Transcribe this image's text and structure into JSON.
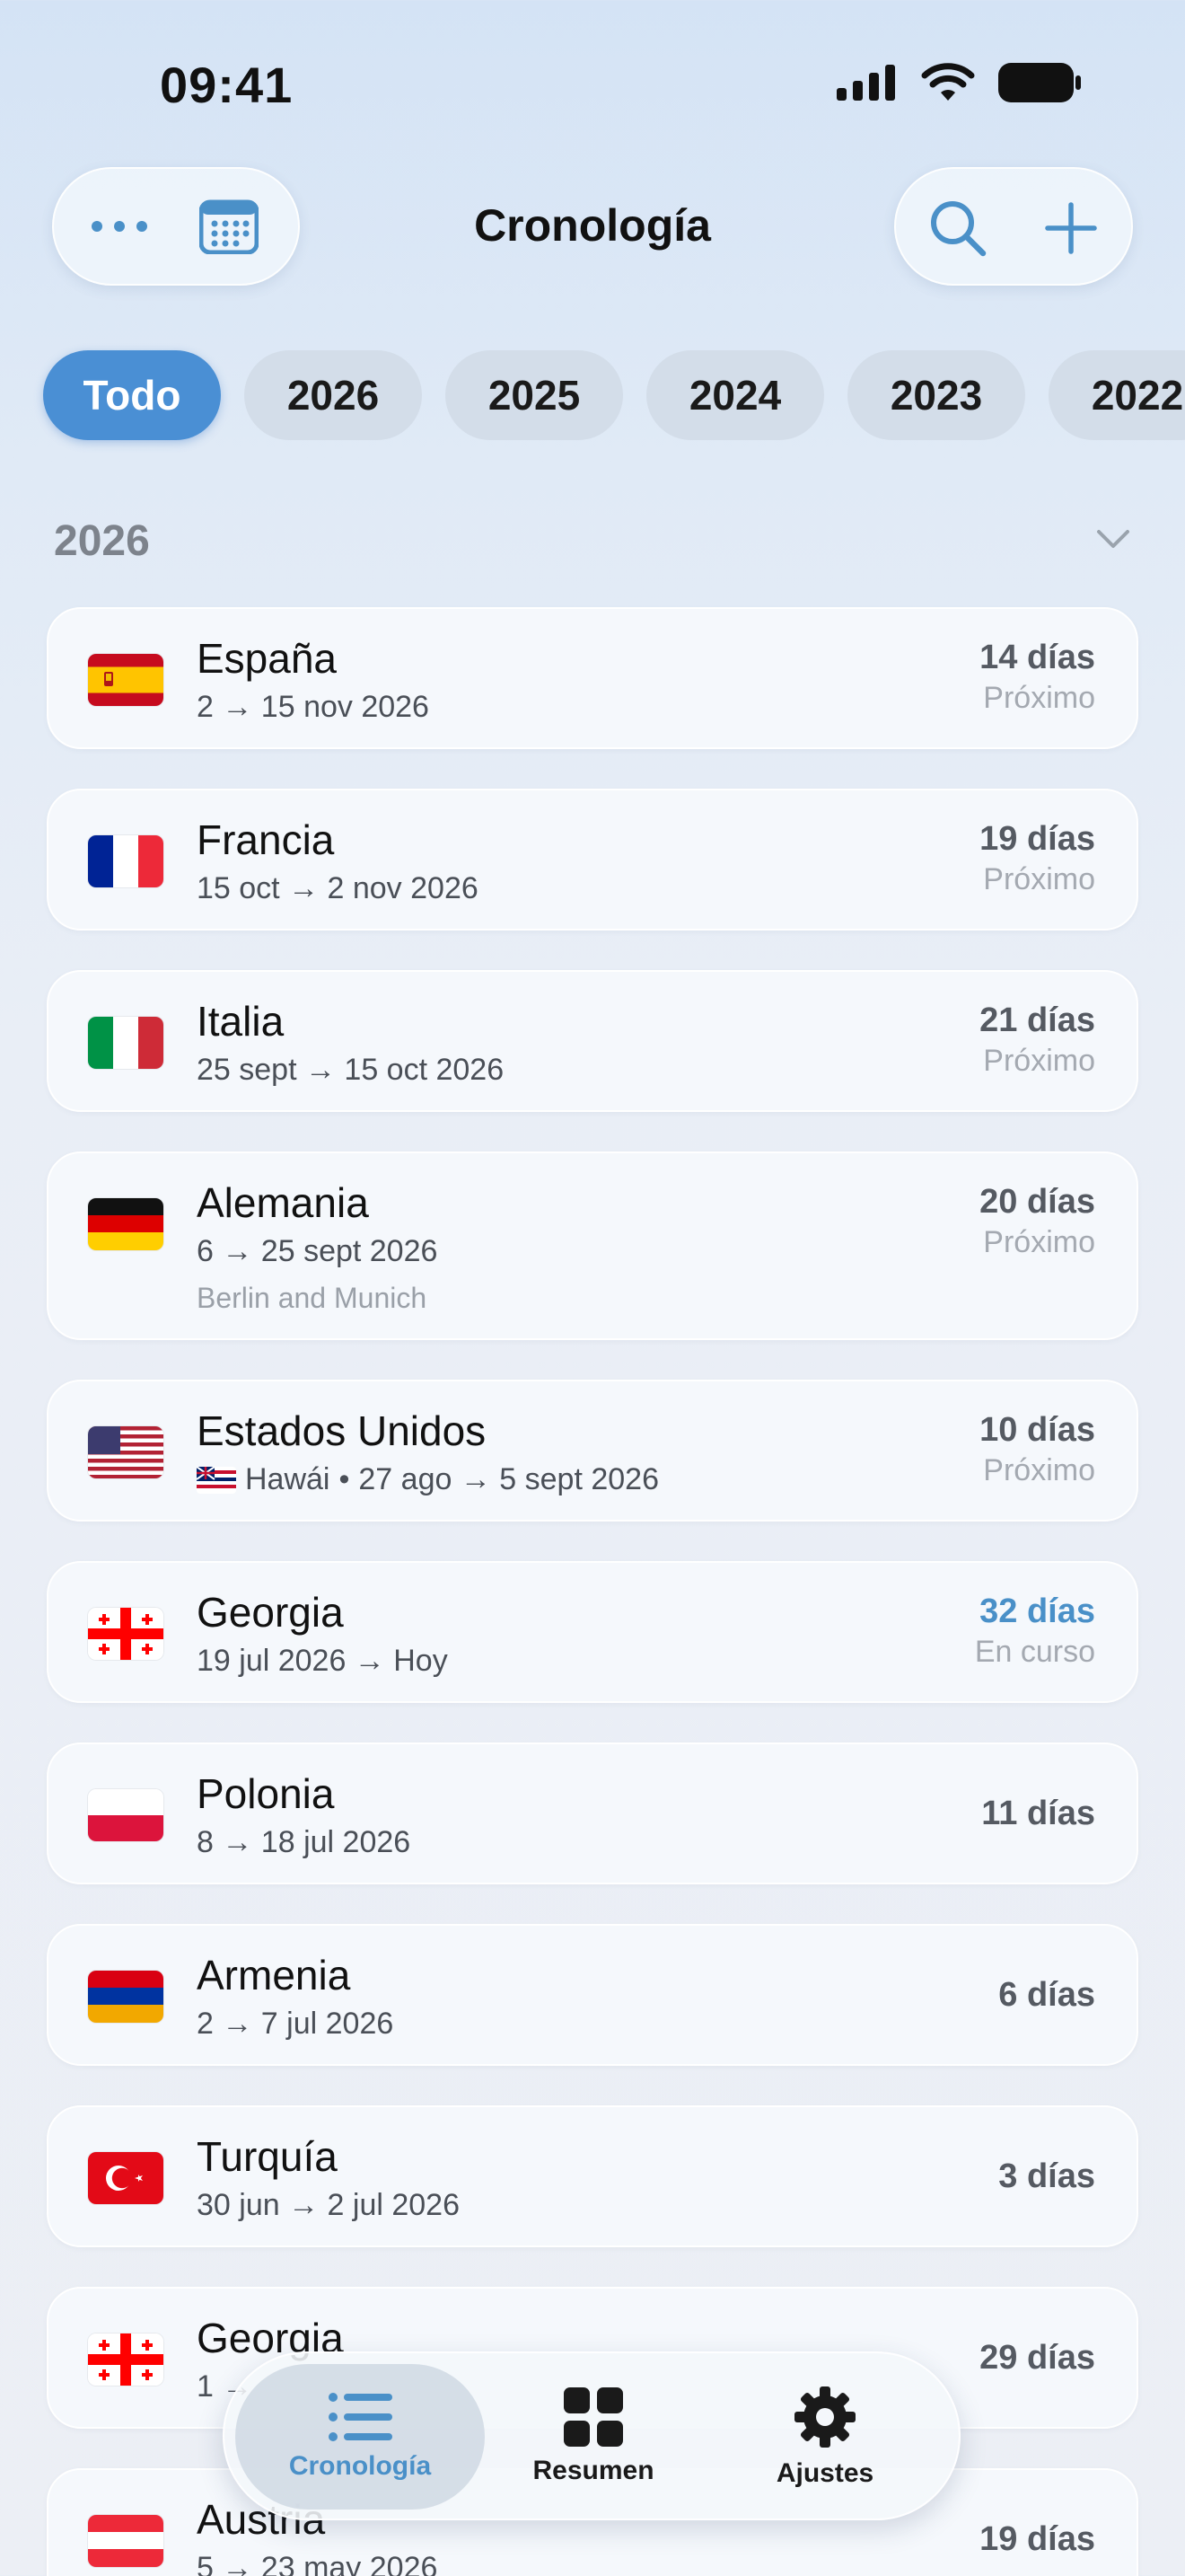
{
  "status": {
    "time": "09:41"
  },
  "nav": {
    "title": "Cronología"
  },
  "filters": [
    "Todo",
    "2026",
    "2025",
    "2024",
    "2023",
    "2022"
  ],
  "section": {
    "year": "2026"
  },
  "trips": [
    {
      "country": "España",
      "dates": "2 → 15 nov 2026",
      "days": "14 días",
      "status": "Próximo"
    },
    {
      "country": "Francia",
      "dates": "15 oct → 2 nov 2026",
      "days": "19 días",
      "status": "Próximo"
    },
    {
      "country": "Italia",
      "dates": "25 sept → 15 oct 2026",
      "days": "21 días",
      "status": "Próximo"
    },
    {
      "country": "Alemania",
      "dates": "6 → 25 sept 2026",
      "note": "Berlin and Munich",
      "days": "20 días",
      "status": "Próximo"
    },
    {
      "country": "Estados Unidos",
      "region": "Hawái",
      "dates": "27 ago → 5 sept 2026",
      "days": "10 días",
      "status": "Próximo"
    },
    {
      "country": "Georgia",
      "dates": "19 jul 2026 → Hoy",
      "days": "32 días",
      "status": "En curso"
    },
    {
      "country": "Polonia",
      "dates": "8 → 18 jul 2026",
      "days": "11 días"
    },
    {
      "country": "Armenia",
      "dates": "2 → 7 jul 2026",
      "days": "6 días"
    },
    {
      "country": "Turquía",
      "dates": "30 jun → 2 jul 2026",
      "days": "3 días"
    },
    {
      "country": "Georgia",
      "dates": "1 →",
      "days": "29 días"
    },
    {
      "country": "Austria",
      "dates": "5 → 23 may 2026",
      "days": "19 días"
    }
  ],
  "tabs": [
    {
      "label": "Cronología",
      "icon": "list-icon"
    },
    {
      "label": "Resumen",
      "icon": "grid-icon"
    },
    {
      "label": "Ajustes",
      "icon": "gear-icon"
    }
  ],
  "colors": {
    "accent": "#4a90c8",
    "chip_active": "#4a8fd4"
  }
}
